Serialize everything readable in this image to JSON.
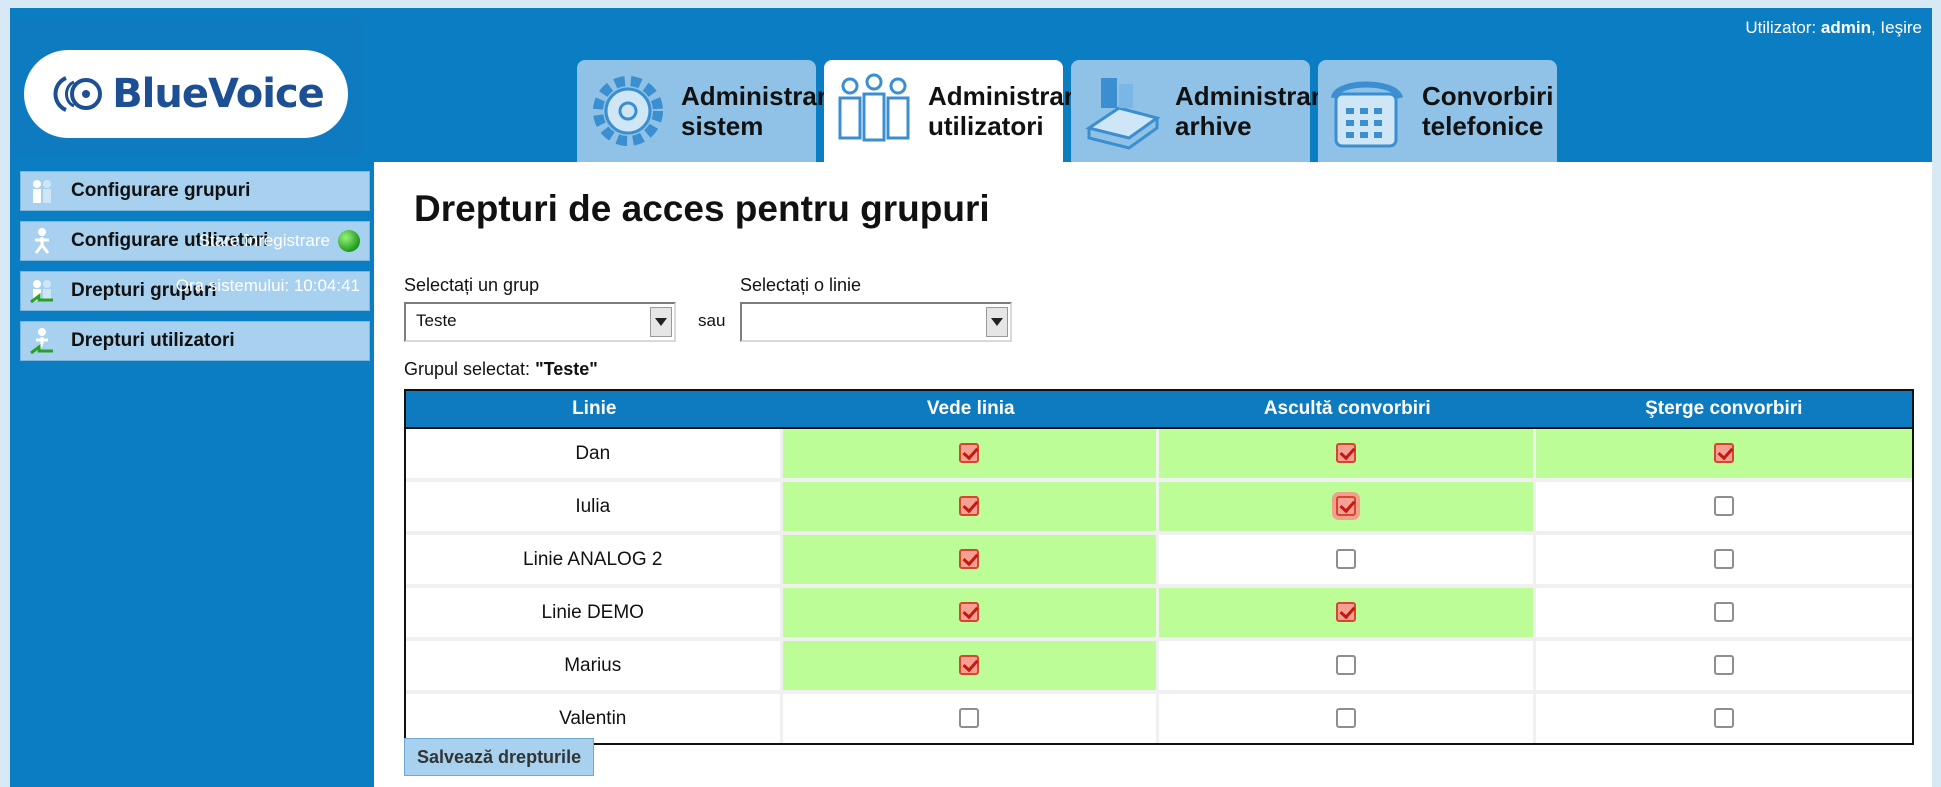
{
  "header": {
    "user_label": "Utilizator:",
    "user_name": "admin",
    "logout": "Ieşire",
    "logo_text": "BlueVoice"
  },
  "tabs": [
    {
      "label": "Administrare\nsistem",
      "icon": "gear-icon",
      "active": false
    },
    {
      "label": "Administrare\nutilizatori",
      "icon": "users-icon",
      "active": true
    },
    {
      "label": "Administrare\narhive",
      "icon": "archive-icon",
      "active": false
    },
    {
      "label": "Convorbiri\ntelefonice",
      "icon": "telephone-icon",
      "active": false
    }
  ],
  "sidebar": {
    "items": [
      {
        "label": "Configurare grupuri",
        "icon": "group-icon"
      },
      {
        "label": "Configurare utilizatori",
        "icon": "user-icon"
      },
      {
        "label": "Drepturi grupuri",
        "icon": "group-rights-icon"
      },
      {
        "label": "Drepturi utilizatori",
        "icon": "user-rights-icon"
      }
    ],
    "status_label": "Stare înregistrare",
    "status_color": "#1d9a1d",
    "clock_label": "Ora sistemului: 10:04:41"
  },
  "main": {
    "title": "Drepturi de acces pentru grupuri",
    "group_select_label": "Selectați un grup",
    "group_select_value": "Teste",
    "or_label": "sau",
    "line_select_label": "Selectați o linie",
    "line_select_value": "",
    "selected_group_label": "Grupul selectat:",
    "selected_group_value": "\"Teste\"",
    "table": {
      "columns": [
        "Linie",
        "Vede linia",
        "Ascultă convorbiri",
        "Şterge convorbiri"
      ],
      "rows": [
        {
          "line": "Dan",
          "view": true,
          "listen": true,
          "delete": true
        },
        {
          "line": "Iulia",
          "view": true,
          "listen": true,
          "delete": false
        },
        {
          "line": "Linie ANALOG 2",
          "view": true,
          "listen": false,
          "delete": false
        },
        {
          "line": "Linie DEMO",
          "view": true,
          "listen": true,
          "delete": false
        },
        {
          "line": "Marius",
          "view": true,
          "listen": false,
          "delete": false
        },
        {
          "line": "Valentin",
          "view": false,
          "listen": false,
          "delete": false
        }
      ]
    },
    "save_label": "Salvează drepturile"
  },
  "colors": {
    "header_blue": "#0b7dc3",
    "tab_blue": "#8fc2e6",
    "checked_cell": "#bdfd98",
    "checkbox_red": "#c11b0d"
  }
}
